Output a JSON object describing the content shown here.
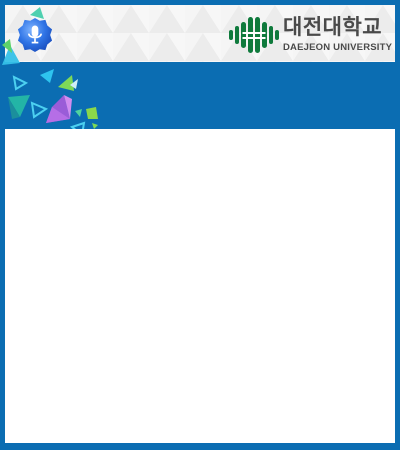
{
  "header": {
    "mic_icon": "microphone-icon",
    "logo": {
      "name_kr": "대전대학교",
      "name_en": "DAEJEON UNIVERSITY",
      "mark_icon": "university-emblem-icon"
    }
  },
  "colors": {
    "frame_blue": "#0b6db2",
    "header_bg": "#f5f5f5",
    "logo_green": "#0f7a3c",
    "content_bg": "#ffffff"
  }
}
